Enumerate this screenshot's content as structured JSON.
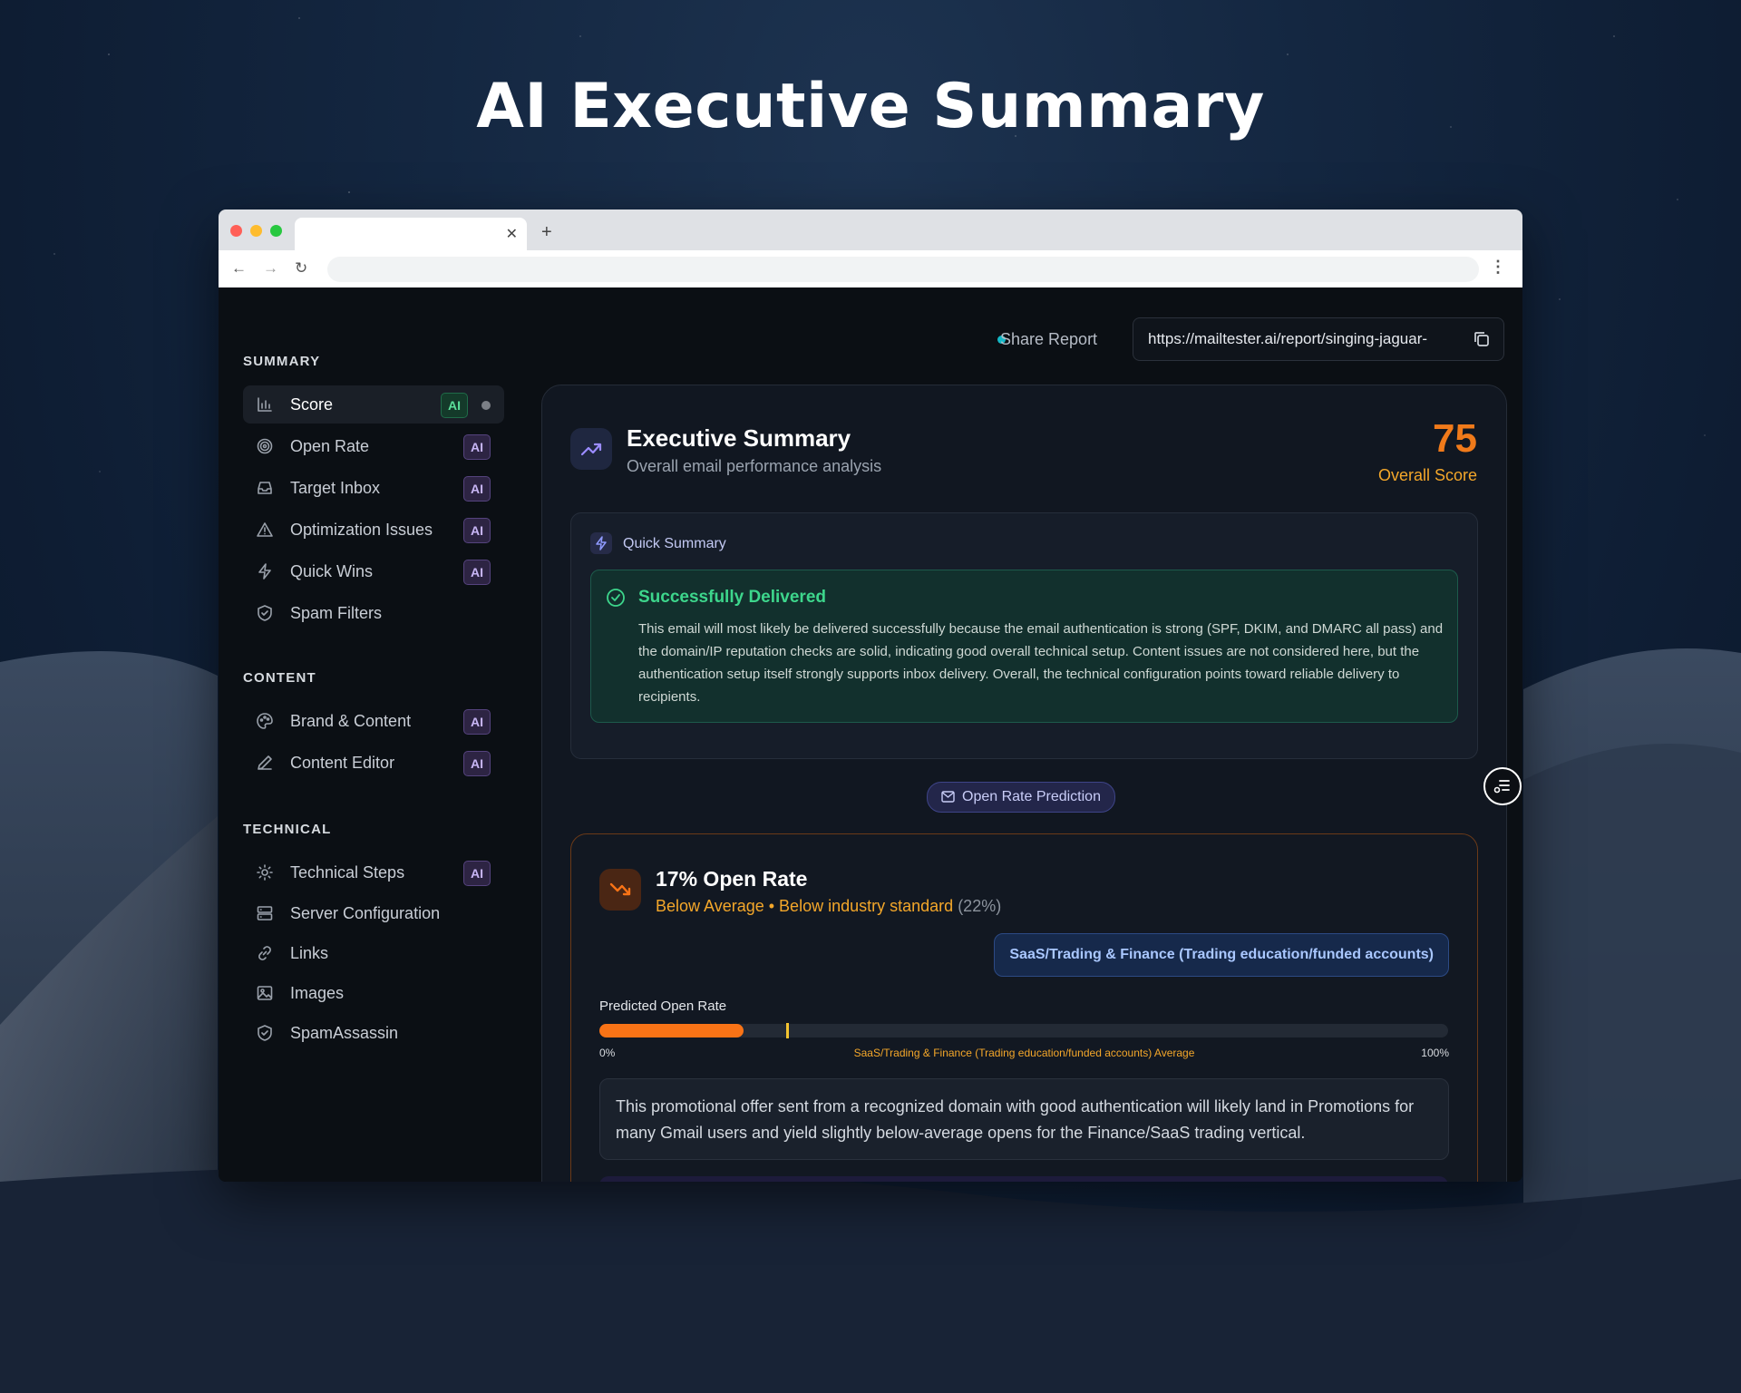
{
  "hero": {
    "title": "AI Executive Summary"
  },
  "sidebar": {
    "sections": [
      {
        "title": "SUMMARY",
        "items": [
          {
            "label": "Score",
            "badge": "AI",
            "active": true
          },
          {
            "label": "Open Rate",
            "badge": "AI"
          },
          {
            "label": "Target Inbox",
            "badge": "AI"
          },
          {
            "label": "Optimization Issues",
            "badge": "AI"
          },
          {
            "label": "Quick Wins",
            "badge": "AI"
          },
          {
            "label": "Spam Filters",
            "badge": ""
          }
        ]
      },
      {
        "title": "CONTENT",
        "items": [
          {
            "label": "Brand & Content",
            "badge": "AI"
          },
          {
            "label": "Content Editor",
            "badge": "AI"
          }
        ]
      },
      {
        "title": "TECHNICAL",
        "items": [
          {
            "label": "Technical Steps",
            "badge": "AI"
          },
          {
            "label": "Server Configuration",
            "badge": ""
          },
          {
            "label": "Links",
            "badge": ""
          },
          {
            "label": "Images",
            "badge": ""
          },
          {
            "label": "SpamAssassin",
            "badge": ""
          }
        ]
      }
    ]
  },
  "share": {
    "label": "Share Report",
    "url": "https://mailtester.ai/report/singing-jaguar-"
  },
  "executive": {
    "title": "Executive Summary",
    "subtitle": "Overall email performance analysis",
    "score": "75",
    "score_label": "Overall Score"
  },
  "quick_summary": {
    "label": "Quick Summary",
    "status_title": "Successfully Delivered",
    "status_text": "This email will most likely be delivered successfully because the email authentication is strong (SPF, DKIM, and DMARC all pass) and the domain/IP reputation checks are solid, indicating good overall technical setup. Content issues are not considered here, but the authentication setup itself strongly supports inbox delivery. Overall, the technical configuration points toward reliable delivery to recipients."
  },
  "open_rate": {
    "pill": "Open Rate Prediction",
    "title": "17% Open Rate",
    "sub_status": "Below Average • Below industry standard",
    "sub_paren": "(22%)",
    "industry": "SaaS/Trading & Finance (Trading education/funded accounts)",
    "bar_label": "Predicted Open Rate",
    "predicted_pct": 17,
    "industry_avg_pct": 22,
    "tick_min": "0%",
    "tick_mid": "SaaS/Trading & Finance (Trading education/funded accounts) Average",
    "tick_max": "100%",
    "description": "This promotional offer sent from a recognized domain with good authentication will likely land in Promotions for many Gmail users and yield slightly below-average opens for the Finance/SaaS trading vertical."
  },
  "colors": {
    "accent_orange": "#f97316",
    "success_green": "#3dd68c",
    "ai_badge_purple": "#c8b6f5"
  }
}
